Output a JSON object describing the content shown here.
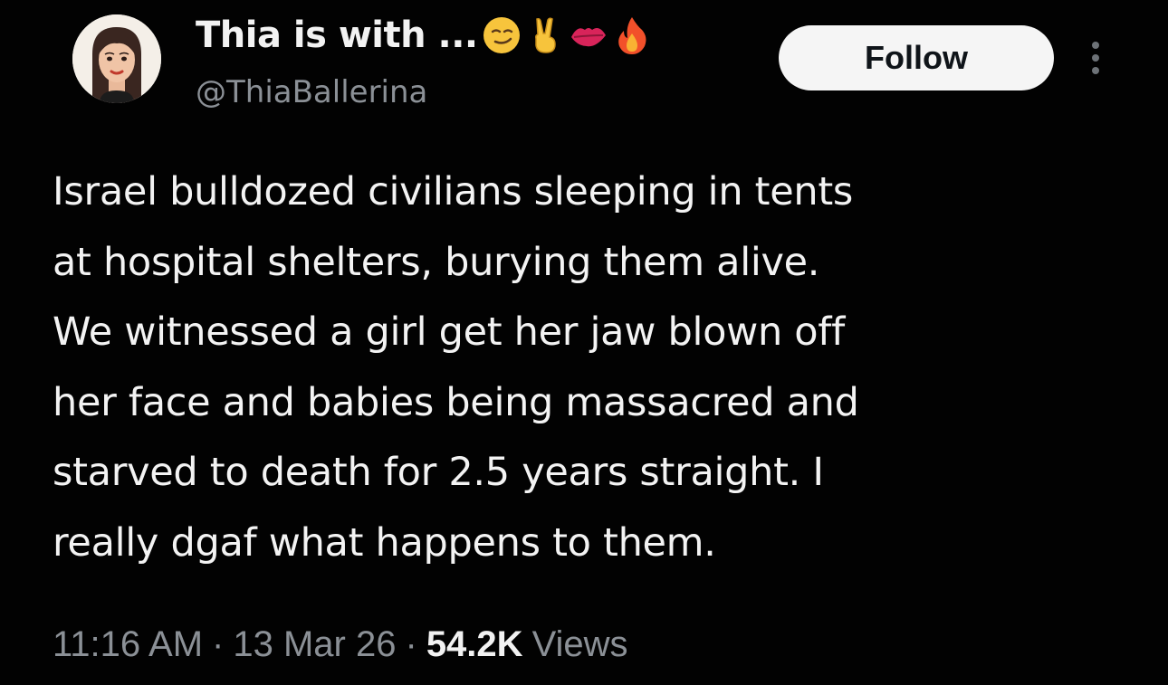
{
  "tweet": {
    "display_name": "Thia is with ...",
    "name_emojis": [
      "smirk-emoji",
      "victory-hand-emoji",
      "kiss-lips-emoji",
      "fire-emoji"
    ],
    "handle": "@ThiaBallerina",
    "follow_label": "Follow",
    "more_icon": "more-vertical-icon",
    "text_lines": [
      "Israel bulldozed civilians sleeping in tents",
      "at hospital shelters, burying them alive.",
      "We witnessed a girl get her jaw blown off",
      "her face and babies being massacred and",
      "starved to death for 2.5 years straight. I",
      "really dgaf what happens to them."
    ],
    "time": "11:16 AM",
    "separator": "·",
    "date": "13 Mar 26",
    "views_count": "54.2K",
    "views_label": "Views"
  },
  "colors": {
    "background": "#020202",
    "text_primary": "#f3f3f3",
    "text_secondary": "#8b9096",
    "follow_bg": "#f5f5f5",
    "follow_text": "#0f1419"
  }
}
